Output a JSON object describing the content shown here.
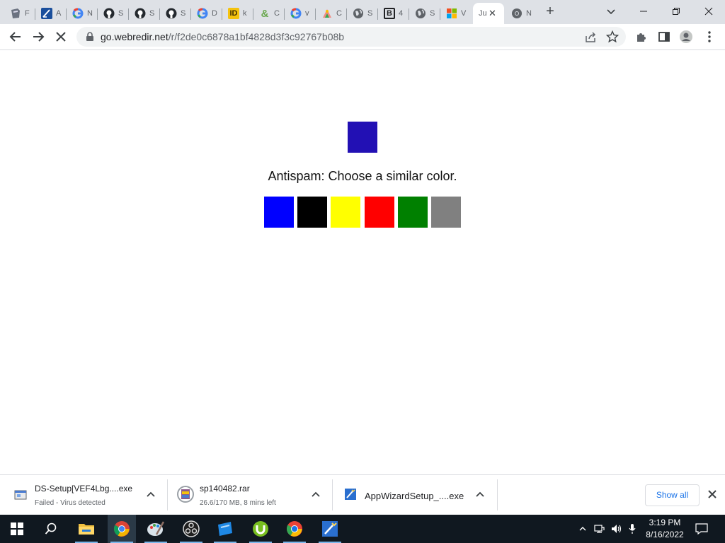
{
  "browser": {
    "tabs": [
      {
        "title": "F",
        "icon": "pdf-doc-icon"
      },
      {
        "title": "A",
        "icon": "sketch-app-icon"
      },
      {
        "title": "N",
        "icon": "google-icon"
      },
      {
        "title": "S",
        "icon": "github-icon"
      },
      {
        "title": "S",
        "icon": "github-icon"
      },
      {
        "title": "S",
        "icon": "github-icon"
      },
      {
        "title": "D",
        "icon": "google-icon"
      },
      {
        "title": "k",
        "icon": "id-app-icon"
      },
      {
        "title": "C",
        "icon": "ampersand-icon"
      },
      {
        "title": "v",
        "icon": "google-icon"
      },
      {
        "title": "C",
        "icon": "colorful-app-icon"
      },
      {
        "title": "S",
        "icon": "globe-icon"
      },
      {
        "title": "4",
        "icon": "bold-b-icon"
      },
      {
        "title": "S",
        "icon": "globe-icon"
      },
      {
        "title": "V",
        "icon": "windows-logo-icon"
      },
      {
        "title": "Ju",
        "icon": "none",
        "active": true
      },
      {
        "title": "N",
        "icon": "chromium-icon"
      }
    ],
    "new_tab_label": "+",
    "address": {
      "domain": "go.webredir.net",
      "path": "/r/f2de0c6878a1bf4828d3f3c92767b08b"
    }
  },
  "page": {
    "prompt": "Antispam: Choose a similar color.",
    "target_color": "#2210b4",
    "choices": [
      {
        "name": "blue",
        "color": "#0000ff"
      },
      {
        "name": "black",
        "color": "#000000"
      },
      {
        "name": "yellow",
        "color": "#ffff00"
      },
      {
        "name": "red",
        "color": "#ff0000"
      },
      {
        "name": "green",
        "color": "#008000"
      },
      {
        "name": "gray",
        "color": "#808080"
      }
    ]
  },
  "downloads": {
    "items": [
      {
        "name": "DS-Setup[VEF4Lbg....exe",
        "status": "Failed - Virus detected",
        "icon": "installer-icon"
      },
      {
        "name": "sp140482.rar",
        "status": "26.6/170 MB, 8 mins left",
        "icon": "winrar-icon"
      },
      {
        "name": "AppWizardSetup_....exe",
        "status": "",
        "icon": "app-wizard-icon"
      }
    ],
    "show_all_label": "Show all"
  },
  "taskbar": {
    "apps": [
      "start-icon",
      "search-icon",
      "file-explorer-icon",
      "chrome-icon",
      "paint-icon",
      "obs-icon",
      "blue-app-icon",
      "utorrent-icon",
      "chrome-color-icon",
      "app-wizard-icon"
    ],
    "time": "3:19 PM",
    "date": "8/16/2022"
  }
}
